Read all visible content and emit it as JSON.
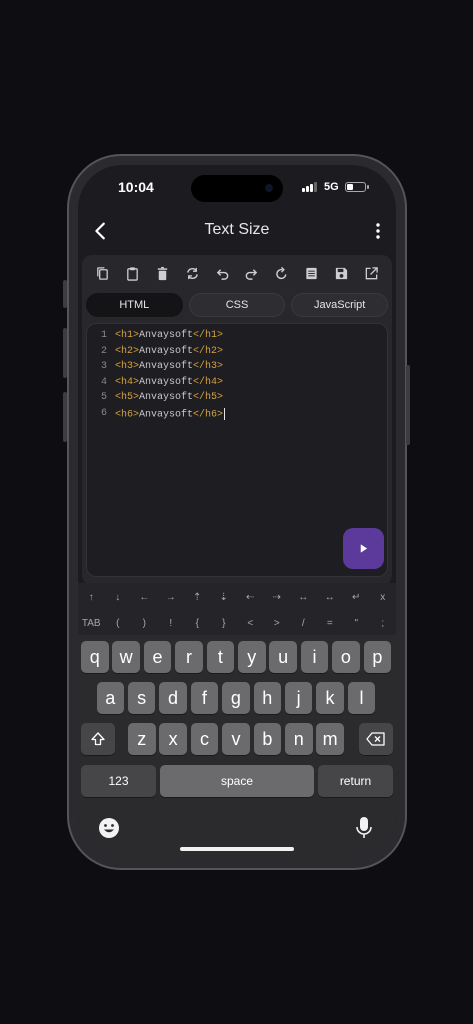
{
  "status": {
    "time": "10:04",
    "network": "5G",
    "battery_level": 0.35
  },
  "appbar": {
    "title": "Text Size"
  },
  "toolbar": {
    "icons": [
      "copy-icon",
      "clipboard-icon",
      "trash-icon",
      "replace-icon",
      "undo-icon",
      "redo-icon",
      "refresh-icon",
      "document-icon",
      "save-icon",
      "open-external-icon"
    ]
  },
  "tabs": [
    {
      "label": "HTML",
      "active": true
    },
    {
      "label": "CSS",
      "active": false
    },
    {
      "label": "JavaScript",
      "active": false
    }
  ],
  "code": [
    {
      "num": "1",
      "open": "<h1>",
      "text": "Anvaysoft",
      "close": "</h1>"
    },
    {
      "num": "2",
      "open": "<h2>",
      "text": "Anvaysoft",
      "close": "</h2>"
    },
    {
      "num": "3",
      "open": "<h3>",
      "text": "Anvaysoft",
      "close": "</h3>"
    },
    {
      "num": "4",
      "open": "<h4>",
      "text": "Anvaysoft",
      "close": "</h4>"
    },
    {
      "num": "5",
      "open": "<h5>",
      "text": "Anvaysoft",
      "close": "</h5>"
    },
    {
      "num": "6",
      "open": "<h6>",
      "text": "Anvaysoft",
      "close": "</h6>"
    }
  ],
  "accessory": {
    "row1": [
      "↑",
      "↓",
      "←",
      "→",
      "⇡",
      "⇣",
      "⇠",
      "⇢",
      "↔",
      "↔",
      "↵",
      "x"
    ],
    "row2": [
      "TAB",
      "(",
      ")",
      "!",
      "{",
      "}",
      "<",
      ">",
      "/",
      "=",
      "\"",
      ";"
    ]
  },
  "keyboard": {
    "row1": [
      "q",
      "w",
      "e",
      "r",
      "t",
      "y",
      "u",
      "i",
      "o",
      "p"
    ],
    "row2": [
      "a",
      "s",
      "d",
      "f",
      "g",
      "h",
      "j",
      "k",
      "l"
    ],
    "row3": [
      "z",
      "x",
      "c",
      "v",
      "b",
      "n",
      "m"
    ],
    "numbers_label": "123",
    "space_label": "space",
    "return_label": "return"
  },
  "colors": {
    "accent": "#5b3a9c",
    "tag": "#d4a23e"
  }
}
